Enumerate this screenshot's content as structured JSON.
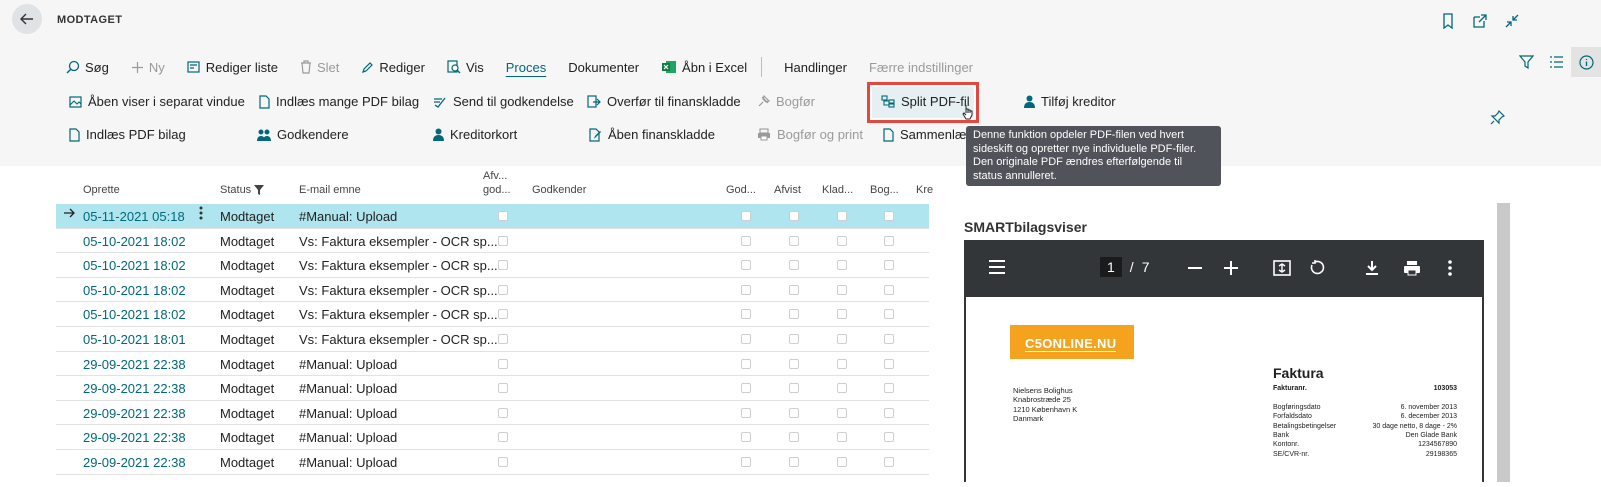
{
  "header": {
    "title": "MODTAGET"
  },
  "toolbar": {
    "tabs": [
      {
        "label": "Søg",
        "icon": "search-icon"
      },
      {
        "label": "Ny",
        "icon": "plus-icon",
        "disabled": true
      },
      {
        "label": "Rediger liste",
        "icon": "edit-list-icon"
      },
      {
        "label": "Slet",
        "icon": "trash-icon",
        "disabled": true
      },
      {
        "label": "Rediger",
        "icon": "pencil-icon"
      },
      {
        "label": "Vis",
        "icon": "view-icon"
      },
      {
        "label": "Proces",
        "active": true
      },
      {
        "label": "Dokumenter"
      },
      {
        "label": "Åbn i Excel",
        "icon": "excel-icon"
      },
      {
        "label": "Handlinger"
      },
      {
        "label": "Færre indstillinger",
        "disabled": true
      }
    ]
  },
  "actions": {
    "open_viewer": "Åben viser i separat vindue",
    "load_many_pdf": "Indlæs mange PDF bilag",
    "send_approval": "Send til godkendelse",
    "transfer_journal": "Overfør til finanskladde",
    "post": "Bogfør",
    "split_pdf": "Split PDF-fil",
    "add_vendor": "Tilføj kreditor",
    "load_pdf": "Indlæs PDF bilag",
    "approvers": "Godkendere",
    "vendor_card": "Kreditorkort",
    "open_journal": "Åben finanskladde",
    "post_print": "Bogfør og print",
    "merge": "Sammenlæg"
  },
  "tooltip": {
    "text": "Denne funktion opdeler PDF-filen ved hvert sideskift og opretter nye individuelle PDF-filer. Den originale PDF ændres efterfølgende til status annulleret."
  },
  "grid": {
    "columns": {
      "created": "Oprette",
      "status": "Status",
      "subject": "E-mail emne",
      "rejected_approval_1": "Afv...",
      "rejected_approval_2": "god...",
      "approver": "Godkender",
      "approved": "God...",
      "rejected": "Afvist",
      "journal": "Klad...",
      "posted": "Bog...",
      "vendor": "Kre"
    },
    "rows": [
      {
        "date": "05-11-2021 05:18",
        "status": "Modtaget",
        "subject": "#Manual: Upload",
        "selected": true
      },
      {
        "date": "05-10-2021 18:02",
        "status": "Modtaget",
        "subject": "Vs: Faktura eksempler - OCR sp..."
      },
      {
        "date": "05-10-2021 18:02",
        "status": "Modtaget",
        "subject": "Vs: Faktura eksempler - OCR sp..."
      },
      {
        "date": "05-10-2021 18:02",
        "status": "Modtaget",
        "subject": "Vs: Faktura eksempler - OCR sp..."
      },
      {
        "date": "05-10-2021 18:02",
        "status": "Modtaget",
        "subject": "Vs: Faktura eksempler - OCR sp..."
      },
      {
        "date": "05-10-2021 18:01",
        "status": "Modtaget",
        "subject": "Vs: Faktura eksempler - OCR sp..."
      },
      {
        "date": "29-09-2021 22:38",
        "status": "Modtaget",
        "subject": "#Manual: Upload"
      },
      {
        "date": "29-09-2021 22:38",
        "status": "Modtaget",
        "subject": "#Manual: Upload"
      },
      {
        "date": "29-09-2021 22:38",
        "status": "Modtaget",
        "subject": "#Manual: Upload"
      },
      {
        "date": "29-09-2021 22:38",
        "status": "Modtaget",
        "subject": "#Manual: Upload"
      },
      {
        "date": "29-09-2021 22:38",
        "status": "Modtaget",
        "subject": "#Manual: Upload"
      }
    ]
  },
  "viewer": {
    "title": "SMARTbilagsviser",
    "page_current": "1",
    "page_sep": "/",
    "page_total": "7",
    "document": {
      "logo": "C5ONLINE.NU",
      "address": [
        "Nielsens Bolighus",
        "Knabrostræde 25",
        "1210 København K",
        "Danmark"
      ],
      "heading": "Faktura",
      "fields": [
        {
          "label": "Fakturanr.",
          "value": "103053",
          "bold": true
        },
        {
          "label": "",
          "value": ""
        },
        {
          "label": "Bogføringsdato",
          "value": "6. november 2013"
        },
        {
          "label": "Forfaldsdato",
          "value": "6. december 2013"
        },
        {
          "label": "Betalingsbetingelser",
          "value": "30 dage netto, 8 dage - 2%"
        },
        {
          "label": "Bank",
          "value": "Den Glade Bank"
        },
        {
          "label": "Kontonr.",
          "value": "1234567890"
        },
        {
          "label": "SE/CVR-nr.",
          "value": "29198365"
        }
      ]
    }
  },
  "colors": {
    "accent": "#00687a",
    "selected_row": "#aee5ee",
    "highlight_border": "#e2483d",
    "logo_orange": "#f5a21e",
    "pdf_background": "#323639"
  }
}
